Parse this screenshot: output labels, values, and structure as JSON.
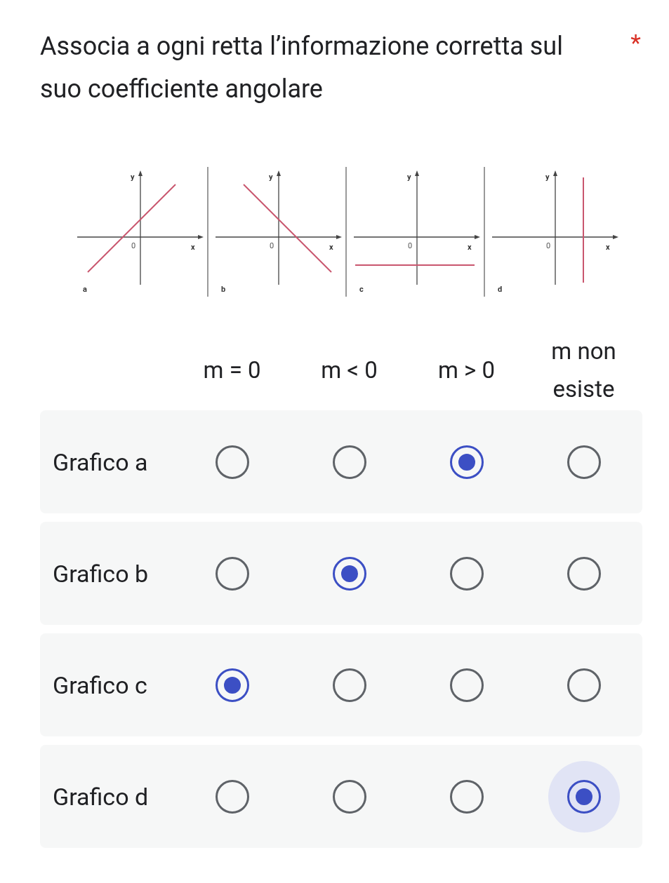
{
  "question": {
    "title": "Associa a ogni retta l’informazione corretta sul suo coefficiente angolare",
    "required_mark": "*"
  },
  "graphs": [
    {
      "kind": "rising",
      "label": "a",
      "y_label": "y",
      "x_label": "x",
      "origin": "0"
    },
    {
      "kind": "falling",
      "label": "b",
      "y_label": "y",
      "x_label": "x",
      "origin": "0"
    },
    {
      "kind": "horizontal",
      "label": "c",
      "y_label": "y",
      "x_label": "x",
      "origin": "0"
    },
    {
      "kind": "vertical",
      "label": "d",
      "y_label": "y",
      "x_label": "x",
      "origin": "0"
    }
  ],
  "columns": [
    "m = 0",
    "m < 0",
    "m > 0",
    "m non esiste"
  ],
  "rows": [
    {
      "label": "Grafico a",
      "options": [
        {
          "selected": false,
          "focused": false
        },
        {
          "selected": false,
          "focused": false
        },
        {
          "selected": true,
          "focused": false
        },
        {
          "selected": false,
          "focused": false
        }
      ]
    },
    {
      "label": "Grafico b",
      "options": [
        {
          "selected": false,
          "focused": false
        },
        {
          "selected": true,
          "focused": false
        },
        {
          "selected": false,
          "focused": false
        },
        {
          "selected": false,
          "focused": false
        }
      ]
    },
    {
      "label": "Grafico c",
      "options": [
        {
          "selected": true,
          "focused": false
        },
        {
          "selected": false,
          "focused": false
        },
        {
          "selected": false,
          "focused": false
        },
        {
          "selected": false,
          "focused": false
        }
      ]
    },
    {
      "label": "Grafico d",
      "options": [
        {
          "selected": false,
          "focused": false
        },
        {
          "selected": false,
          "focused": false
        },
        {
          "selected": false,
          "focused": false
        },
        {
          "selected": true,
          "focused": true
        }
      ]
    }
  ]
}
